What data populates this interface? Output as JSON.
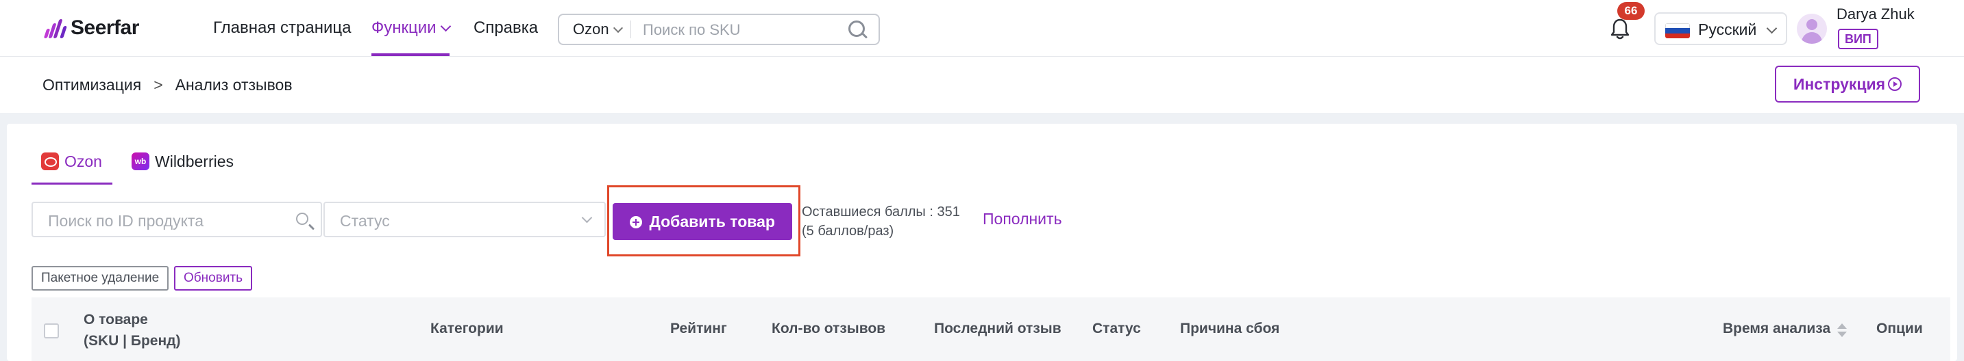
{
  "brand": {
    "name": "Seerfar",
    "colors": {
      "accent": "#8a2bbf",
      "badge": "#d33a2c",
      "highlight": "#e0482a"
    }
  },
  "nav": {
    "items": [
      {
        "label": "Главная страница"
      },
      {
        "label": "Функции",
        "active": true,
        "has_dropdown": true
      },
      {
        "label": "Справка"
      }
    ]
  },
  "search": {
    "marketplace": "Ozon",
    "placeholder": "Поиск по SKU",
    "icon": "search-icon"
  },
  "notifications": {
    "count": "66",
    "icon": "bell-icon"
  },
  "language": {
    "label": "Русский",
    "flag": "russia-flag-icon"
  },
  "user": {
    "name": "Darya Zhuk",
    "tier": "ВИП"
  },
  "breadcrumb": {
    "parent": "Оптимизация",
    "separator": ">",
    "current": "Анализ отзывов"
  },
  "instruction_button": {
    "label": "Инструкция",
    "icon": "play-circle-icon"
  },
  "marketplace_tabs": [
    {
      "label": "Ozon",
      "icon": "ozon-icon",
      "active": true
    },
    {
      "label": "Wildberries",
      "icon": "wildberries-icon",
      "active": false
    }
  ],
  "filters": {
    "product_id_placeholder": "Поиск по ID продукта",
    "status_placeholder": "Статус"
  },
  "add_button": {
    "label": "Добавить товар",
    "icon": "plus-circle-icon"
  },
  "points": {
    "line1": "Оставшиеся баллы : 351",
    "line2": "(5 баллов/раз)"
  },
  "topup_link": "Пополнить",
  "bulk_delete_button": "Пакетное удаление",
  "refresh_button": "Обновить",
  "table": {
    "columns": [
      {
        "line1": "О товаре",
        "line2": "(SKU | Бренд)"
      },
      {
        "label": "Категории"
      },
      {
        "label": "Рейтинг"
      },
      {
        "label": "Кол-во отзывов"
      },
      {
        "label": "Последний отзыв"
      },
      {
        "label": "Статус"
      },
      {
        "label": "Причина сбоя"
      },
      {
        "label": "Время анализа",
        "sortable": true
      },
      {
        "label": "Опции"
      }
    ]
  }
}
